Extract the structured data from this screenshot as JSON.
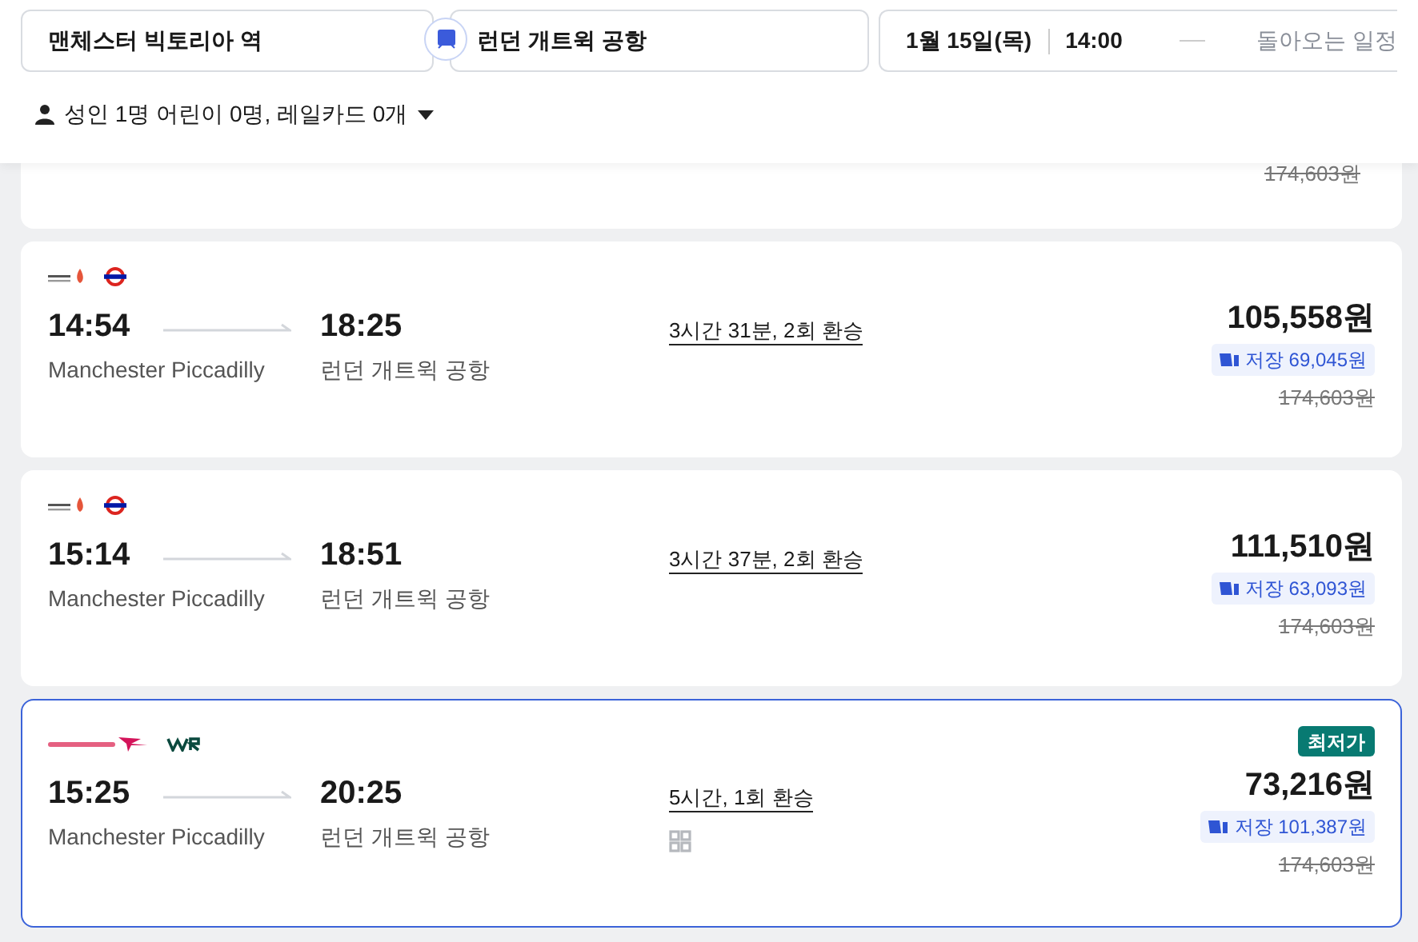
{
  "search": {
    "origin": "맨체스터 빅토리아 역",
    "destination": "런던 개트윅 공항",
    "date": "1월 15일(목)",
    "time": "14:00",
    "return_placeholder": "돌아오는 일정",
    "passengers": "성인 1명 어린이 0명, 레일카드 0개"
  },
  "partial_card": {
    "original_price": "174,603원"
  },
  "journeys": [
    {
      "operators": [
        {
          "kind": "avanti"
        },
        {
          "kind": "underground"
        }
      ],
      "depart": "14:54",
      "arrive": "18:25",
      "from": "Manchester Piccadilly",
      "to": "런던 개트윅 공항",
      "duration": "3시간 31분, 2회 환승",
      "mobile_ticket": false,
      "price": "105,558원",
      "saving": "저장 69,045원",
      "original_price": "174,603원",
      "selected": false
    },
    {
      "operators": [
        {
          "kind": "avanti"
        },
        {
          "kind": "underground"
        }
      ],
      "depart": "15:14",
      "arrive": "18:51",
      "from": "Manchester Piccadilly",
      "to": "런던 개트윅 공항",
      "duration": "3시간 37분, 2회 환승",
      "mobile_ticket": false,
      "price": "111,510원",
      "saving": "저장 63,093원",
      "original_price": "174,603원",
      "selected": false
    },
    {
      "operators": [
        {
          "kind": "crosscountry"
        },
        {
          "kind": "gwr"
        }
      ],
      "badge": "최저가",
      "depart": "15:25",
      "arrive": "20:25",
      "from": "Manchester Piccadilly",
      "to": "런던 개트윅 공항",
      "duration": "5시간, 1회 환승",
      "mobile_ticket": true,
      "price": "73,216원",
      "saving": "저장 101,387원",
      "original_price": "174,603원",
      "selected": true
    }
  ]
}
